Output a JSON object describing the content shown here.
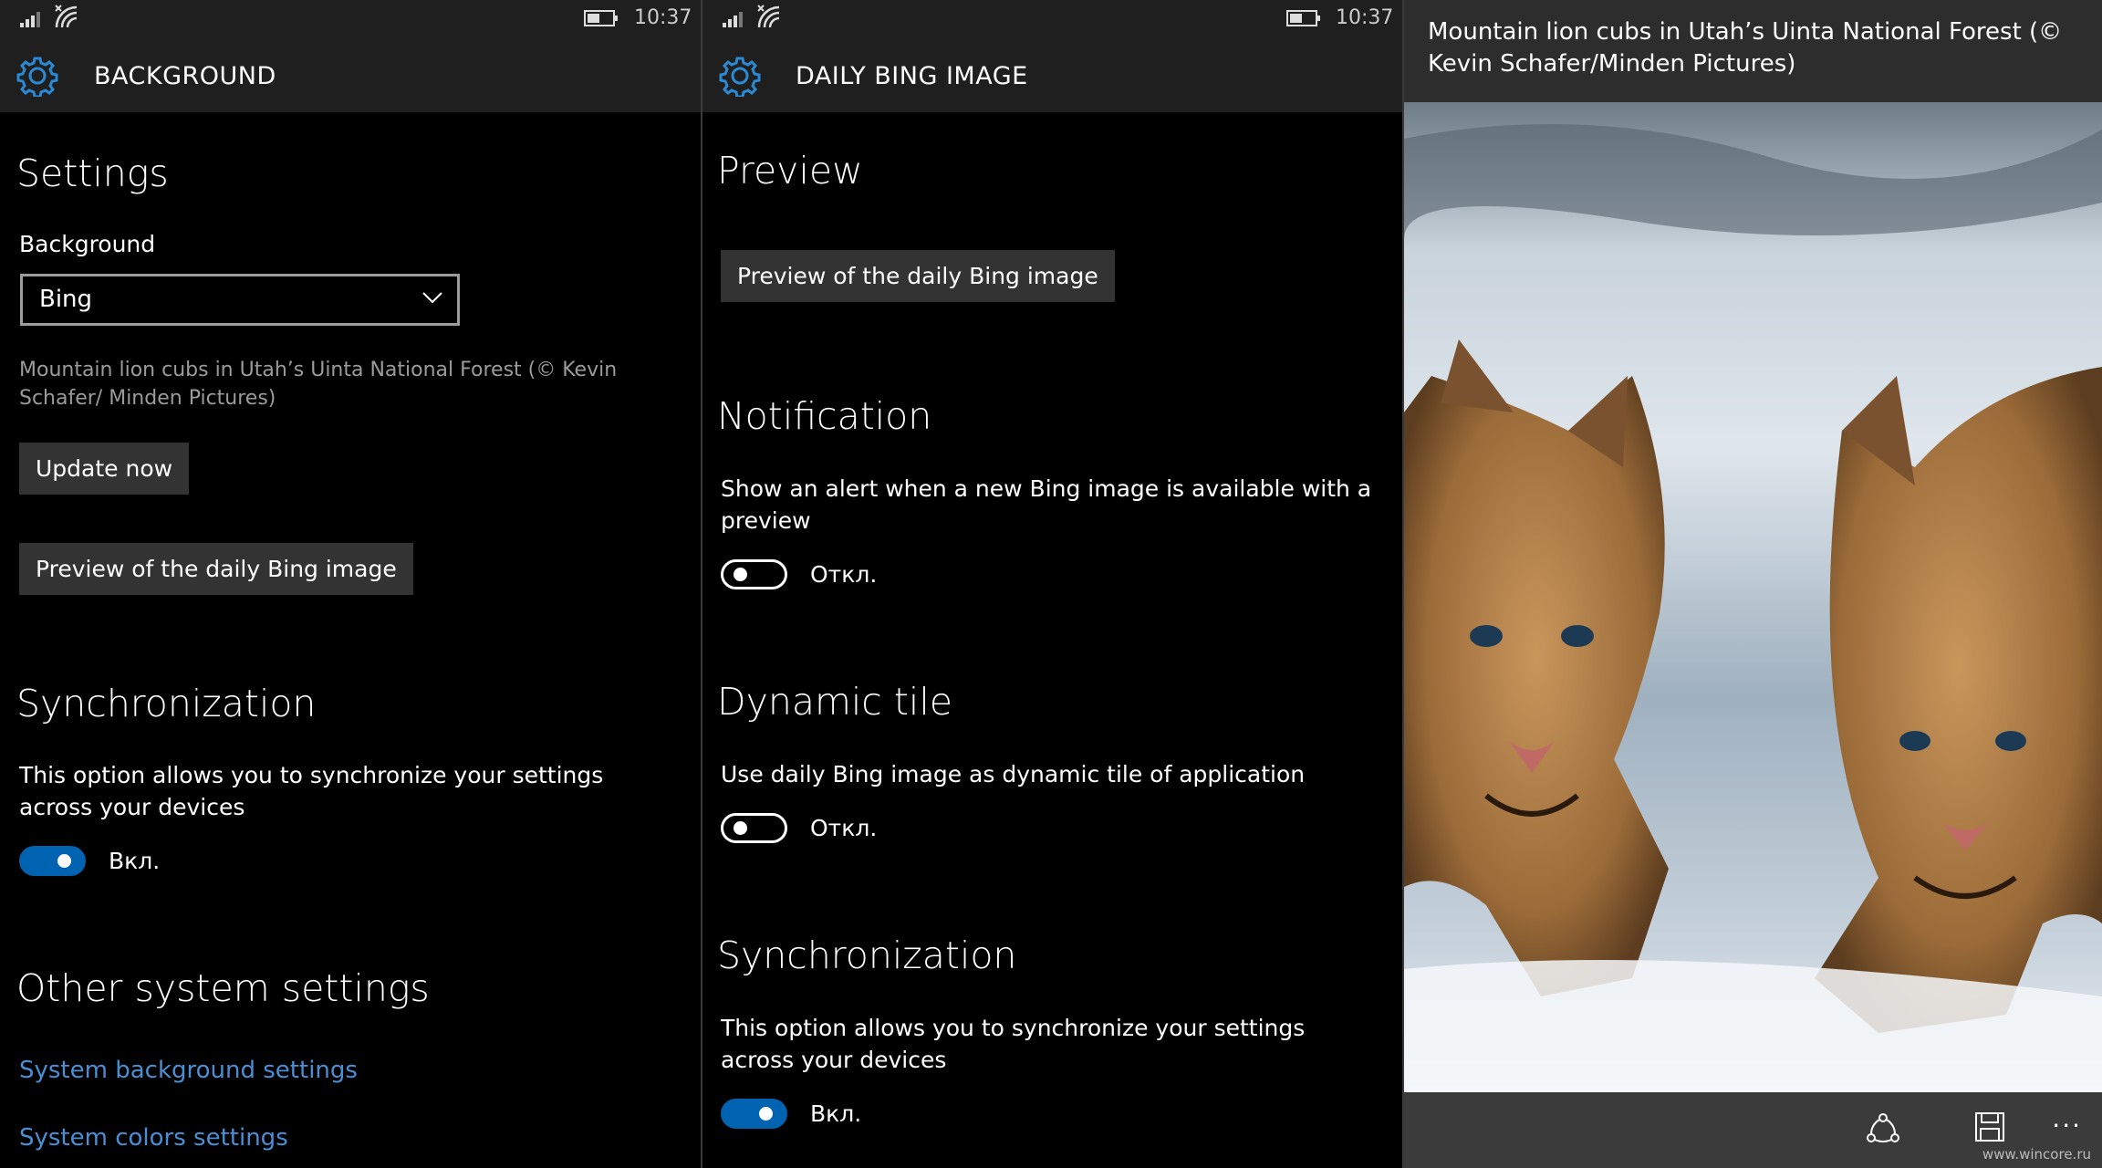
{
  "status": {
    "time": "10:37"
  },
  "panel1": {
    "title": "BACKGROUND",
    "settings_heading": "Settings",
    "background_label": "Background",
    "background_value": "Bing",
    "caption": "Mountain lion cubs in Utah’s Uinta National Forest (© Kevin Schafer/ Minden Pictures)",
    "update_button": "Update now",
    "preview_button": "Preview of the daily Bing image",
    "sync_heading": "Synchronization",
    "sync_text": "This option allows you to synchronize your settings across your devices",
    "sync_toggle_label": "Вкл.",
    "other_heading": "Other system settings",
    "link_background": "System background settings",
    "link_colors": "System colors settings"
  },
  "panel2": {
    "title": "DAILY BING IMAGE",
    "preview_heading": "Preview",
    "preview_button": "Preview of the daily Bing image",
    "notification_heading": "Notification",
    "notification_text": "Show an alert when a new Bing image is available with a preview",
    "notification_toggle_label": "Откл.",
    "tile_heading": "Dynamic tile",
    "tile_text": "Use daily Bing image as dynamic tile of application",
    "tile_toggle_label": "Откл.",
    "sync_heading": "Synchronization",
    "sync_text": "This option allows you to synchronize your settings across your devices",
    "sync_toggle_label": "Вкл."
  },
  "panel3": {
    "caption": "Mountain lion cubs in Utah’s Uinta National Forest (© Kevin Schafer/Minden Pictures)",
    "more": "...",
    "watermark": "www.wincore.ru"
  },
  "toggles": {
    "p1_sync": true,
    "p2_notification": false,
    "p2_tile": false,
    "p2_sync": true
  },
  "icons": [
    "signal-icon",
    "wifi-icon",
    "battery-icon",
    "gear-icon",
    "chevron-down-icon",
    "share-icon",
    "save-icon",
    "more-icon"
  ],
  "colors": {
    "accent": "#0063b1",
    "link": "#4a8ed4",
    "header": "#1f1f1f",
    "button": "#333333"
  }
}
